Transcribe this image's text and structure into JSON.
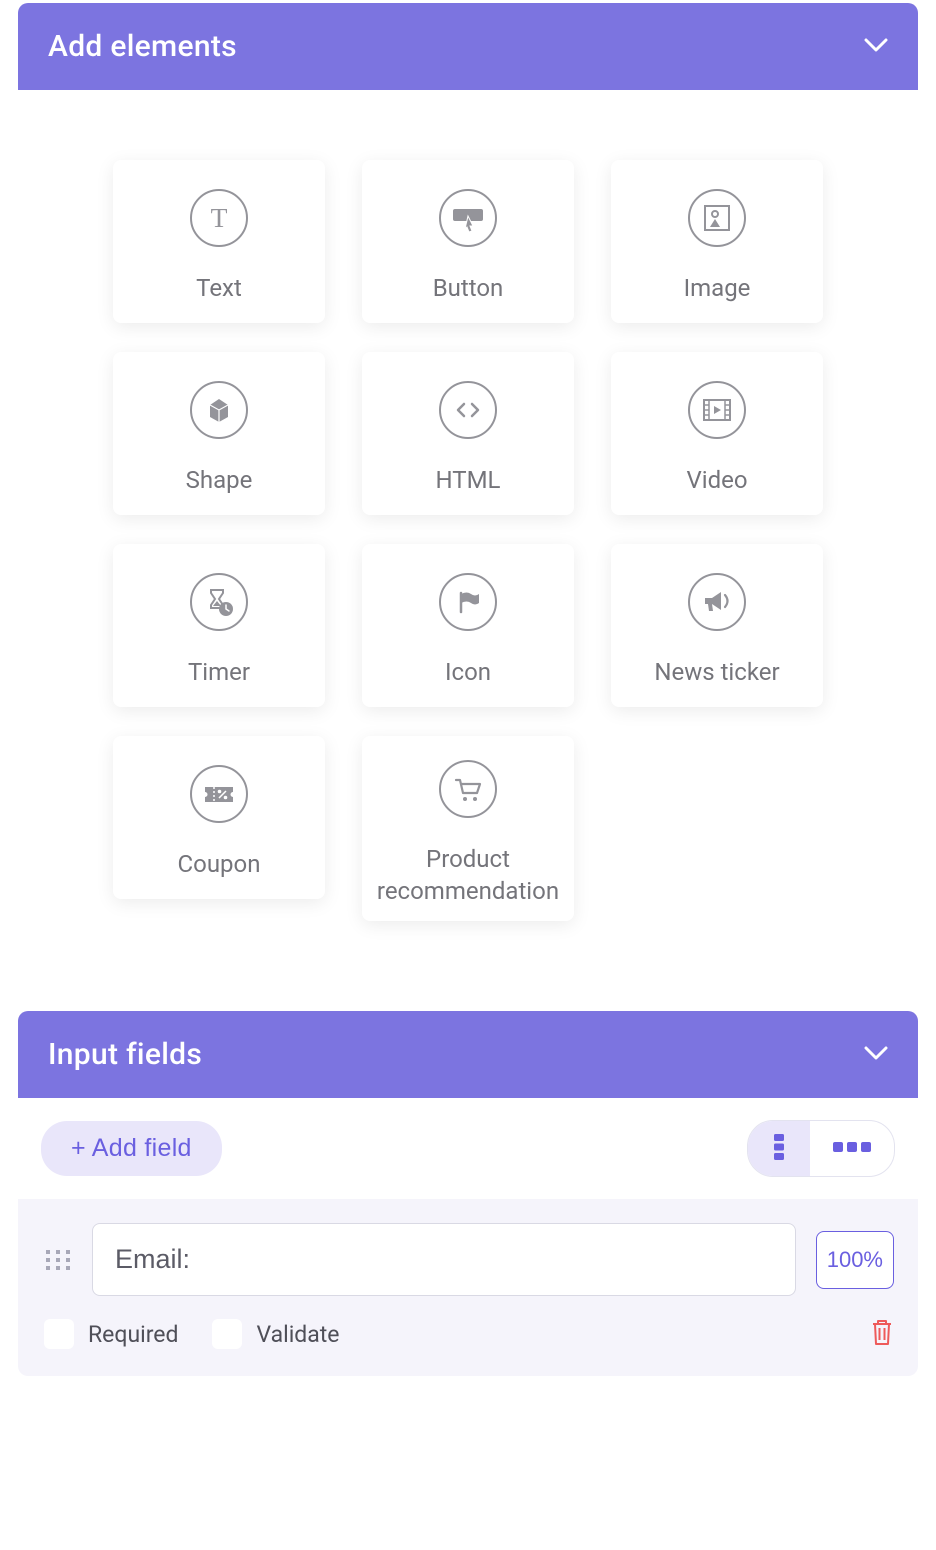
{
  "panels": {
    "addElements": {
      "title": "Add elements",
      "elements": [
        {
          "id": "text",
          "label": "Text",
          "icon": "text-icon"
        },
        {
          "id": "button",
          "label": "Button",
          "icon": "button-icon"
        },
        {
          "id": "image",
          "label": "Image",
          "icon": "image-icon"
        },
        {
          "id": "shape",
          "label": "Shape",
          "icon": "shape-icon"
        },
        {
          "id": "html",
          "label": "HTML",
          "icon": "html-icon"
        },
        {
          "id": "video",
          "label": "Video",
          "icon": "video-icon"
        },
        {
          "id": "timer",
          "label": "Timer",
          "icon": "timer-icon"
        },
        {
          "id": "icon",
          "label": "Icon",
          "icon": "icon-icon"
        },
        {
          "id": "news",
          "label": "News ticker",
          "icon": "news-icon"
        },
        {
          "id": "coupon",
          "label": "Coupon",
          "icon": "coupon-icon"
        },
        {
          "id": "product",
          "label": "Product recommendation",
          "icon": "product-icon"
        }
      ]
    },
    "inputFields": {
      "title": "Input fields",
      "addFieldLabel": "+ Add field",
      "layout": "vertical",
      "fields": [
        {
          "label": "Email:",
          "width": "100%",
          "requiredLabel": "Required",
          "validateLabel": "Validate",
          "required": false,
          "validate": false
        }
      ]
    }
  }
}
